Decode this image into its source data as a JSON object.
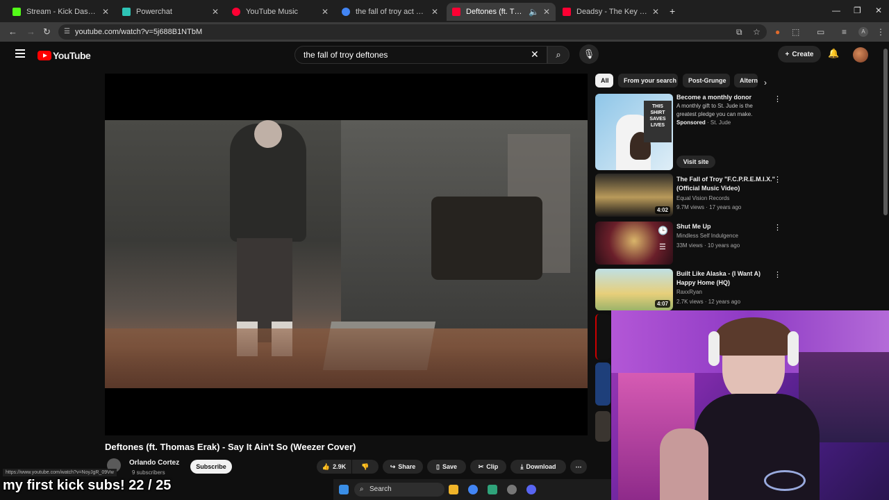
{
  "browser": {
    "tabs": [
      {
        "label": "Stream - Kick Dashboard",
        "fav_color": "#53fc18"
      },
      {
        "label": "Powerchat",
        "fav_color": "#2ec4b6"
      },
      {
        "label": "YouTube Music",
        "fav_color": "#ff0033"
      },
      {
        "label": "the fall of troy act one scene on",
        "fav_color": "#4285f4"
      },
      {
        "label": "Deftones (ft. Thomas Erak)",
        "fav_color": "#ff0033"
      },
      {
        "label": "Deadsy - The Key To Gramercy",
        "fav_color": "#ff0033"
      }
    ],
    "new_tab": "+",
    "url": "youtube.com/watch?v=5j688B1NTbM",
    "status_url": "https://www.youtube.com/watch?v=NoyJgR_09Vw"
  },
  "youtube": {
    "logo_text": "YouTube",
    "search_query": "the fall of troy deftones",
    "create_label": "Create",
    "video": {
      "title": "Deftones (ft. Thomas Erak) - Say It Ain't So (Weezer Cover)",
      "channel": "Orlando Cortez",
      "subscribers": "9 subscribers",
      "subscribe_label": "Subscribe",
      "likes": "2.9K",
      "share_label": "Share",
      "save_label": "Save",
      "clip_label": "Clip",
      "download_label": "Download"
    },
    "chips": [
      "All",
      "From your search",
      "Post-Grunge",
      "Altern"
    ],
    "sidebar": {
      "ad": {
        "title": "Become a monthly donor",
        "desc_line1": "A monthly gift to St. Jude is the",
        "desc_line2": "greatest pledge you can make.",
        "sponsored": "Sponsored",
        "advertiser": "· St. Jude",
        "cta": "Visit site",
        "thumb_text": "THIS SHIRT SAVES LIVES"
      },
      "items": [
        {
          "title_line1": "The Fall of Troy \"F.C.P.R.E.M.I.X.\"",
          "title_line2": "(Official Music Video)",
          "channel": "Equal Vision Records",
          "meta": "9.7M views · 17 years ago",
          "duration": "4:02"
        },
        {
          "title_line1": "Shut Me Up",
          "title_line2": "",
          "channel": "Mindless Self Indulgence",
          "meta": "33M views · 10 years ago",
          "duration": ""
        },
        {
          "title_line1": "Built Like Alaska - (I Want A)",
          "title_line2": "Happy Home (HQ)",
          "channel": "RaxxRyan",
          "meta": "2.7K views · 12 years ago",
          "duration": "4:07"
        }
      ]
    }
  },
  "overlay": {
    "sub_goal": "my first kick subs!  22 / 25"
  },
  "taskbar": {
    "search_label": "Search"
  }
}
